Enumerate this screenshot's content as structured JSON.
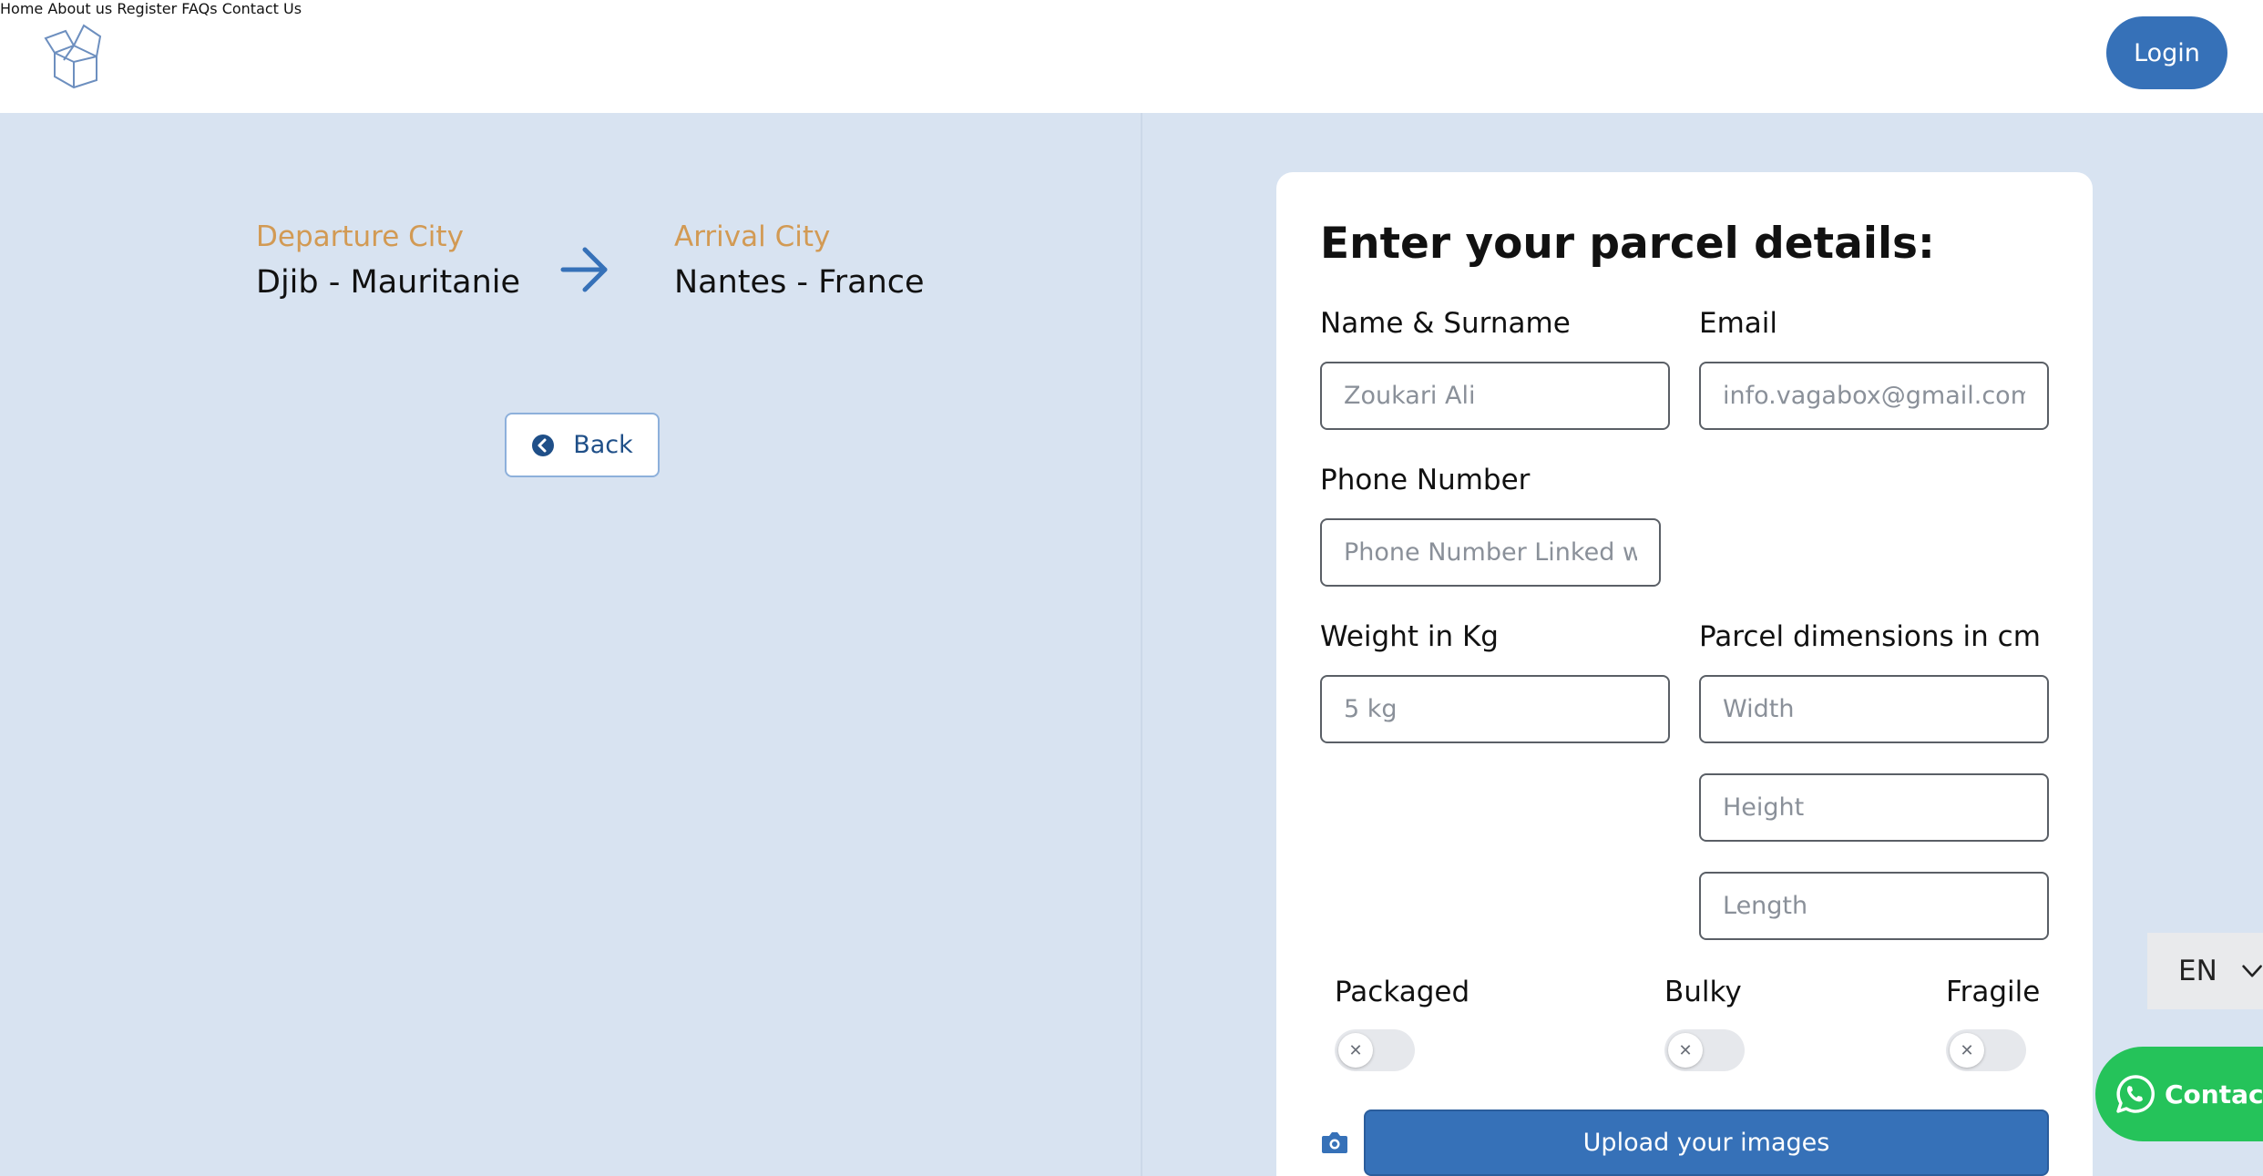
{
  "nav": {
    "items": [
      "Home",
      "About us",
      "Register",
      "FAQs",
      "Contact Us"
    ],
    "login_label": "Login"
  },
  "route": {
    "departure_label": "Departure City",
    "departure_value": "Djib - Mauritanie",
    "arrival_label": "Arrival City",
    "arrival_value": "Nantes - France",
    "back_label": "Back"
  },
  "form": {
    "title": "Enter your parcel details:",
    "name_label": "Name & Surname",
    "name_placeholder": "Zoukari Ali",
    "email_label": "Email",
    "email_placeholder": "info.vagabox@gmail.com",
    "phone_label": "Phone Number",
    "phone_placeholder": "Phone Number Linked wit",
    "weight_label": "Weight in Kg",
    "weight_placeholder": "5 kg",
    "dimensions_label": "Parcel dimensions in cm",
    "width_placeholder": "Width",
    "height_placeholder": "Height",
    "length_placeholder": "Length",
    "toggles": [
      {
        "label": "Packaged",
        "on": false
      },
      {
        "label": "Bulky",
        "on": false
      },
      {
        "label": "Fragile",
        "on": false
      }
    ],
    "upload_label": "Upload your images"
  },
  "language": {
    "selected": "EN"
  },
  "contact": {
    "label": "Contact"
  },
  "colors": {
    "primary": "#3671b8",
    "accent_label": "#d29a54",
    "background": "#d8e3f1",
    "whatsapp": "#25c35a"
  },
  "icons": {
    "logo": "box-icon",
    "route_arrow": "arrow-right-icon",
    "back": "chevron-left-circle-icon",
    "upload": "camera-icon",
    "language": "chevron-down-icon",
    "contact": "whatsapp-icon"
  }
}
